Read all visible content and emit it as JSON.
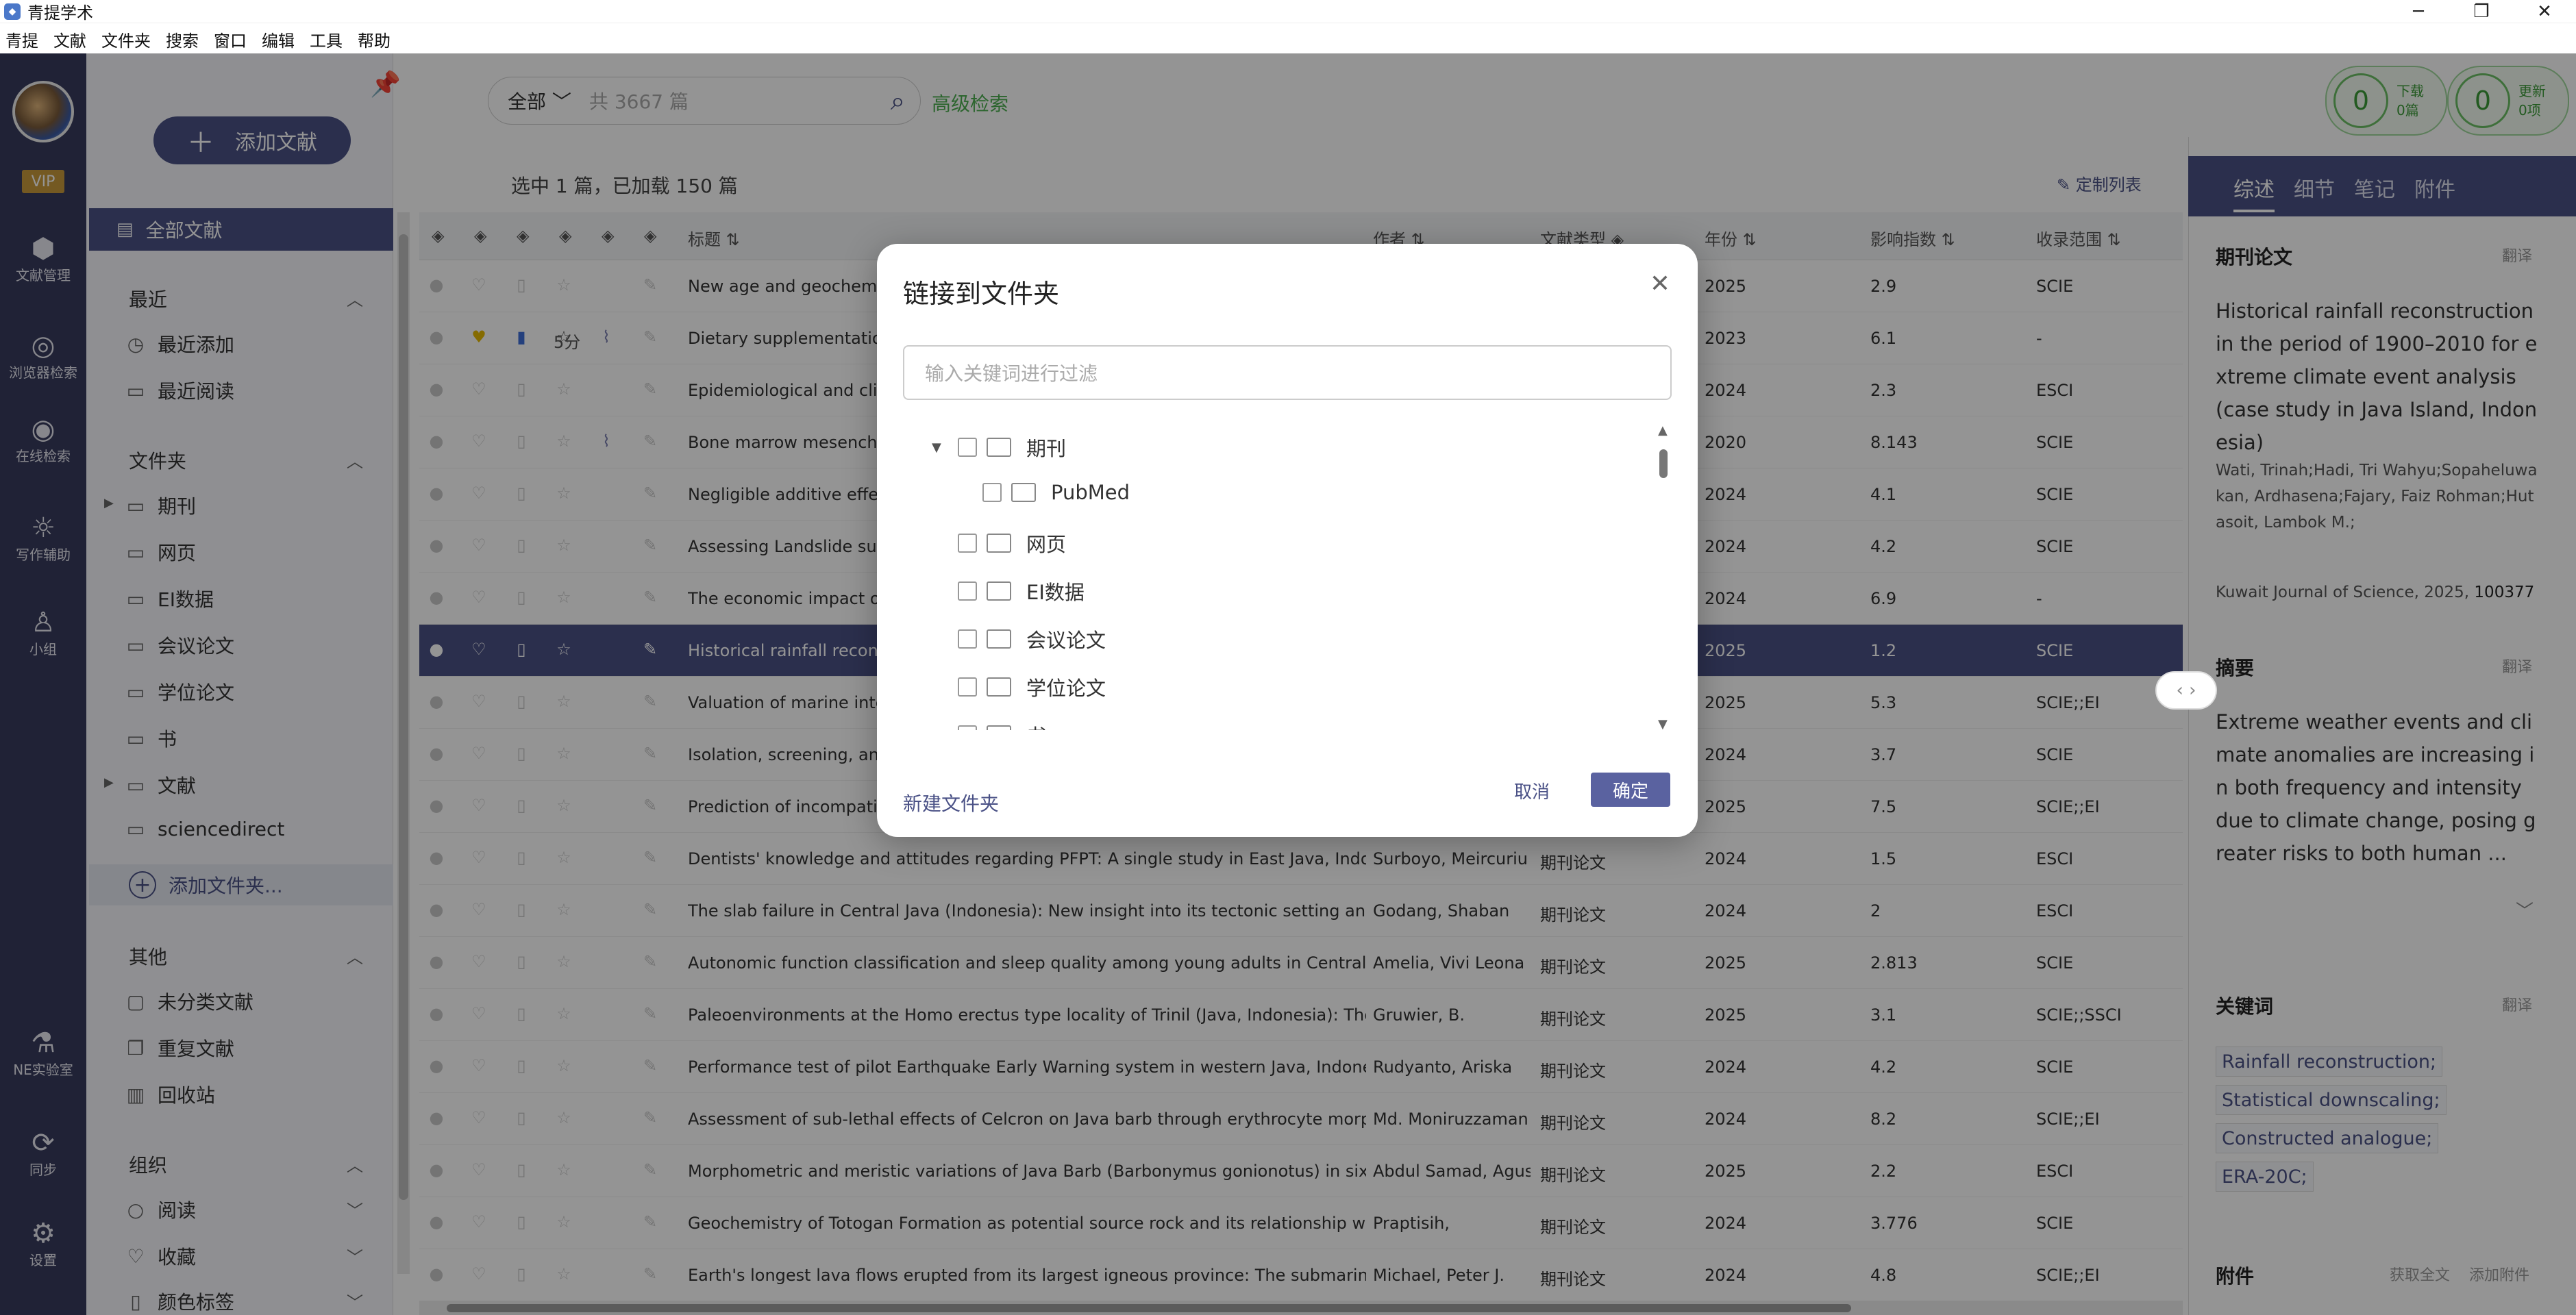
{
  "window": {
    "title": "青提学术",
    "min_icon": "minimize-icon",
    "max_icon": "maximize-icon",
    "close_icon": "close-icon"
  },
  "menu": [
    "青提",
    "文献",
    "文件夹",
    "搜索",
    "窗口",
    "编辑",
    "工具",
    "帮助"
  ],
  "rail": {
    "vip": "VIP",
    "items": [
      {
        "label": "文献管理",
        "icon": "cube-icon"
      },
      {
        "label": "浏览器检索",
        "icon": "browser-icon"
      },
      {
        "label": "在线检索",
        "icon": "eye-icon"
      },
      {
        "label": "写作辅助",
        "icon": "bulb-icon"
      },
      {
        "label": "小组",
        "icon": "user-icon"
      }
    ],
    "bottom": [
      {
        "label": "NE实验室",
        "icon": "microscope-icon"
      },
      {
        "label": "同步",
        "icon": "sync-icon"
      },
      {
        "label": "设置",
        "icon": "gear-icon"
      }
    ]
  },
  "sidebar": {
    "add_label": "添加文献",
    "all_label": "全部文献",
    "recent": {
      "title": "最近",
      "items": [
        "最近添加",
        "最近阅读"
      ]
    },
    "folders": {
      "title": "文件夹",
      "items": [
        "期刊",
        "网页",
        "EI数据",
        "会议论文",
        "学位论文",
        "书",
        "文献",
        "sciencedirect"
      ],
      "expandable": [
        true,
        false,
        false,
        false,
        false,
        false,
        true,
        false
      ]
    },
    "add_folder": "添加文件夹...",
    "other": {
      "title": "其他",
      "items": [
        "未分类文献",
        "重复文献",
        "回收站"
      ]
    },
    "org": {
      "title": "组织",
      "items": [
        "阅读",
        "收藏",
        "颜色标签"
      ]
    }
  },
  "search": {
    "scope": "全部",
    "placeholder": "共 3667 篇",
    "advanced": "高级检索"
  },
  "counters": [
    {
      "value": "0",
      "line1": "下载",
      "line2": "0篇"
    },
    {
      "value": "0",
      "line1": "更新",
      "line2": "0项"
    }
  ],
  "list": {
    "selection_info": "选中 1 篇，已加载 150 篇",
    "custom_label": "定制列表",
    "columns": {
      "title": "标题",
      "author": "作者",
      "type": "文献类型",
      "year": "年份",
      "impact": "影响指数",
      "scope": "收录范围"
    },
    "rows": [
      {
        "title": "New age and geochemi",
        "author": "",
        "type": "",
        "year": "2025",
        "impact": "2.9",
        "scope": "SCIE",
        "fav": false,
        "mark": false,
        "score": "",
        "clip": false,
        "selected": false
      },
      {
        "title": "Dietary supplementation",
        "author": "",
        "type": "",
        "year": "2023",
        "impact": "6.1",
        "scope": "-",
        "fav": true,
        "mark": true,
        "score": "5分",
        "clip": true,
        "selected": false
      },
      {
        "title": "Epidemiological and clir",
        "author": "",
        "type": "",
        "year": "2024",
        "impact": "2.3",
        "scope": "ESCI",
        "fav": false,
        "mark": false,
        "score": "",
        "clip": false,
        "selected": false
      },
      {
        "title": "Bone marrow mesenchy",
        "author": "",
        "type": "",
        "year": "2020",
        "impact": "8.143",
        "scope": "SCIE",
        "fav": false,
        "mark": false,
        "score": "",
        "clip": true,
        "selected": false
      },
      {
        "title": "Negligible additive effec",
        "author": "",
        "type": "",
        "year": "2024",
        "impact": "4.1",
        "scope": "SCIE",
        "fav": false,
        "mark": false,
        "score": "",
        "clip": false,
        "selected": false
      },
      {
        "title": "Assessing Landslide sus",
        "author": "",
        "type": "",
        "year": "2024",
        "impact": "4.2",
        "scope": "SCIE",
        "fav": false,
        "mark": false,
        "score": "",
        "clip": false,
        "selected": false
      },
      {
        "title": "The economic impact of",
        "author": "",
        "type": "",
        "year": "2024",
        "impact": "6.9",
        "scope": "-",
        "fav": false,
        "mark": false,
        "score": "",
        "clip": false,
        "selected": false
      },
      {
        "title": "Historical rainfall recons",
        "author": "",
        "type": "",
        "year": "2025",
        "impact": "1.2",
        "scope": "SCIE",
        "fav": false,
        "mark": false,
        "score": "",
        "clip": false,
        "selected": true
      },
      {
        "title": "Valuation of marine inte",
        "author": "",
        "type": "",
        "year": "2025",
        "impact": "5.3",
        "scope": "SCIE;;EI",
        "fav": false,
        "mark": false,
        "score": "",
        "clip": false,
        "selected": false
      },
      {
        "title": "Isolation, screening, and",
        "author": "",
        "type": "",
        "year": "2024",
        "impact": "3.7",
        "scope": "SCIE",
        "fav": false,
        "mark": false,
        "score": "",
        "clip": false,
        "selected": false
      },
      {
        "title": "Prediction of incompatib",
        "author": "",
        "type": "",
        "year": "2025",
        "impact": "7.5",
        "scope": "SCIE;;EI",
        "fav": false,
        "mark": false,
        "score": "",
        "clip": false,
        "selected": false
      },
      {
        "title": "Dentists' knowledge and attitudes regarding PFPT: A single study in East Java, Indone",
        "author": "Surboyo, Meircuriu",
        "type": "期刊论文",
        "year": "2024",
        "impact": "1.5",
        "scope": "ESCI",
        "fav": false,
        "mark": false,
        "score": "",
        "clip": false,
        "selected": false
      },
      {
        "title": "The slab failure in Central Java (Indonesia): New insight into its tectonic setting and oı",
        "author": "Godang, Shaban",
        "type": "期刊论文",
        "year": "2024",
        "impact": "2",
        "scope": "ESCI",
        "fav": false,
        "mark": false,
        "score": "",
        "clip": false,
        "selected": false
      },
      {
        "title": "Autonomic function classification and sleep quality among young adults in Central Jav",
        "author": "Amelia, Vivi Leona",
        "type": "期刊论文",
        "year": "2025",
        "impact": "2.813",
        "scope": "SCIE",
        "fav": false,
        "mark": false,
        "score": "",
        "clip": false,
        "selected": false
      },
      {
        "title": "Paleoenvironments at the Homo erectus type locality of Trinil (Java, Indonesia): The ar",
        "author": "Gruwier, B.",
        "type": "期刊论文",
        "year": "2025",
        "impact": "3.1",
        "scope": "SCIE;;SSCI",
        "fav": false,
        "mark": false,
        "score": "",
        "clip": false,
        "selected": false
      },
      {
        "title": "Performance test of pilot Earthquake Early Warning system in western Java, Indonesia",
        "author": "Rudyanto, Ariska",
        "type": "期刊论文",
        "year": "2024",
        "impact": "4.2",
        "scope": "SCIE",
        "fav": false,
        "mark": false,
        "score": "",
        "clip": false,
        "selected": false
      },
      {
        "title": "Assessment of sub-lethal effects of Celcron on Java barb through erythrocyte morphc",
        "author": "Md. Moniruzzaman",
        "type": "期刊论文",
        "year": "2024",
        "impact": "8.2",
        "scope": "SCIE;;EI",
        "fav": false,
        "mark": false,
        "score": "",
        "clip": false,
        "selected": false
      },
      {
        "title": "Morphometric and meristic variations of Java Barb (Barbonymus gonionotus) in six di:",
        "author": "Abdul Samad, Agus",
        "type": "期刊论文",
        "year": "2025",
        "impact": "2.2",
        "scope": "ESCI",
        "fav": false,
        "mark": false,
        "score": "",
        "clip": false,
        "selected": false
      },
      {
        "title": "Geochemistry of Totogan Formation as potential source rock and its relationship with",
        "author": "Praptisih,",
        "type": "期刊论文",
        "year": "2024",
        "impact": "3.776",
        "scope": "SCIE",
        "fav": false,
        "mark": false,
        "score": "",
        "clip": false,
        "selected": false
      },
      {
        "title": "Earth's longest lava flows erupted from its largest igneous province: The submarine O",
        "author": "Michael, Peter J.",
        "type": "期刊论文",
        "year": "2024",
        "impact": "4.8",
        "scope": "SCIE;;EI",
        "fav": false,
        "mark": false,
        "score": "",
        "clip": false,
        "selected": false
      }
    ]
  },
  "detail": {
    "tabs": [
      "综述",
      "细节",
      "笔记",
      "附件"
    ],
    "type_label": "期刊论文",
    "translate": "翻译",
    "title": "Historical rainfall reconstruction in the period of 1900–2010 for extreme climate event analysis (case study in Java Island, Indonesia)",
    "authors": "Wati, Trinah;Hadi, Tri Wahyu;Sopaheluwakan, Ardhasena;Fajary, Faiz Rohman;Hutasoit, Lambok M.;",
    "journal": "Kuwait Journal of Science, 2025,",
    "article_no": "100377",
    "abstract_label": "摘要",
    "abstract": "Extreme weather events and climate anomalies are increasing in both frequency and intensity due to climate change, posing greater risks to both human ...",
    "keywords_label": "关键词",
    "keywords": [
      "Rainfall reconstruction;",
      "Statistical downscaling;",
      "Constructed analogue;",
      "ERA-20C;"
    ],
    "attach_label": "附件",
    "get_fulltext": "获取全文",
    "add_attach": "添加附件"
  },
  "modal": {
    "title": "链接到文件夹",
    "filter_placeholder": "输入关键词进行过滤",
    "tree": [
      {
        "label": "期刊",
        "level": 0,
        "expanded": true
      },
      {
        "label": "PubMed",
        "level": 1,
        "expanded": false
      },
      {
        "label": "网页",
        "level": 0,
        "expanded": false
      },
      {
        "label": "EI数据",
        "level": 0,
        "expanded": false
      },
      {
        "label": "会议论文",
        "level": 0,
        "expanded": false
      },
      {
        "label": "学位论文",
        "level": 0,
        "expanded": false
      },
      {
        "label": "书",
        "level": 0,
        "expanded": false
      }
    ],
    "new_folder": "新建文件夹",
    "cancel": "取消",
    "ok": "确定"
  }
}
